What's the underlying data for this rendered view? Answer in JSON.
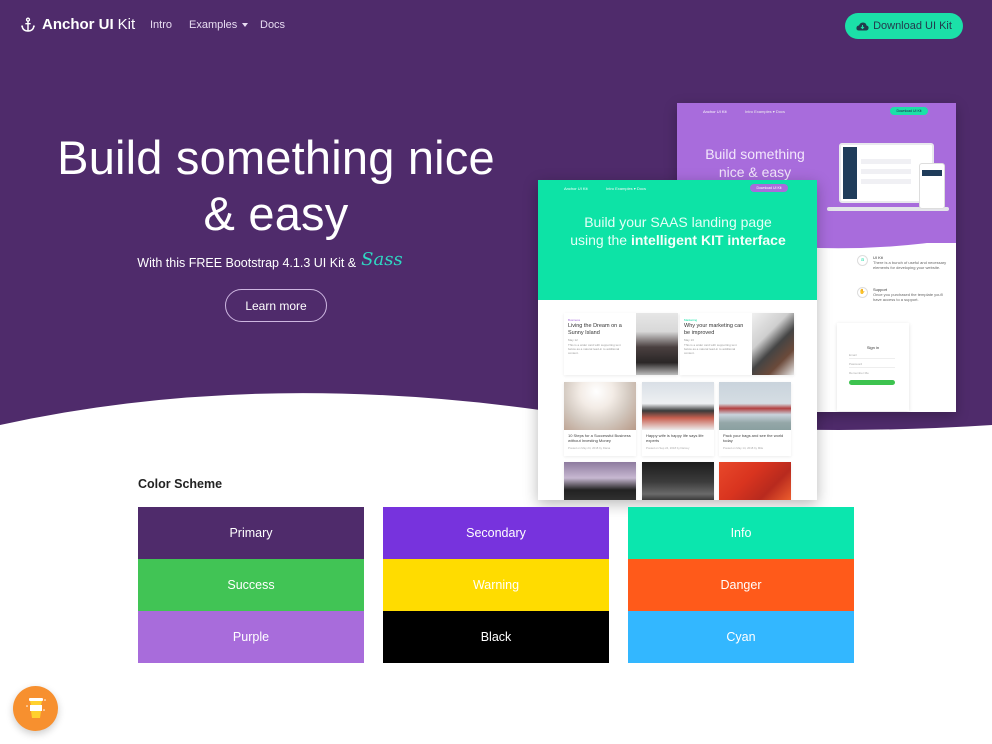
{
  "navbar": {
    "brand_bold": "Anchor UI",
    "brand_light": "Kit",
    "brand_icon": "anchor-icon",
    "links": [
      {
        "label": "Intro"
      },
      {
        "label": "Examples",
        "dropdown": true
      },
      {
        "label": "Docs"
      }
    ],
    "download_button": {
      "label": "Download UI Kit",
      "icon": "cloud-download-icon"
    }
  },
  "hero": {
    "title_line1": "Build something nice",
    "title_line2": "& easy",
    "subtitle": "With this FREE Bootstrap 4.1.3 UI Kit &",
    "sass_logo": "Sass",
    "cta_label": "Learn more",
    "background_color": "#4f2b6b"
  },
  "mockup_back": {
    "brand": "Anchor UI Kit",
    "nav_links": "Intro   Examples ▾   Docs",
    "download_label": "Download UI Kit",
    "title": "Build something nice & easy",
    "features": [
      {
        "icon": "a",
        "title": "UI Kit",
        "text": "There is a bunch of useful and necessary elements for developing your website."
      },
      {
        "icon": "✋",
        "title": "Support",
        "text": "Once you purchased the template you'll have access to a support."
      }
    ],
    "signin": {
      "title": "Sign in",
      "email": "Email",
      "password": "Password",
      "remember": "Remember Me"
    },
    "accent_color": "#a86cdc"
  },
  "mockup_front": {
    "brand": "Anchor UI Kit",
    "nav_links": "Intro   Examples ▾   Docs",
    "download_label": "Download UI Kit",
    "title_plain": "Build your SAAS landing page using the",
    "title_bold": "intelligent KIT interface",
    "accent_color": "#0de3a6",
    "wide_cards": [
      {
        "category": "Business",
        "title": "Living the Dream on a Sunny Island",
        "date": "May 12",
        "text": "This is a wider card with supporting text below as a natural lead-in to additional content."
      },
      {
        "category": "Marketing",
        "title": "Why your marketing can be improved",
        "date": "May 13",
        "text": "This is a wider card with supporting text below as a natural lead-in to additional content."
      }
    ],
    "small_cards": [
      {
        "title": "10 Steps for a Successful Business without Investing Money",
        "meta": "Posted on May 24, 2018 by Diana"
      },
      {
        "title": "Happy wife is happy life says life experts",
        "meta": "Posted on Sep 24, 2018 by Darcey"
      },
      {
        "title": "Pack your bags and see the world today",
        "meta": "Posted on May 14, 2018 by Mila"
      }
    ]
  },
  "color_scheme": {
    "title": "Color Scheme",
    "columns": [
      [
        {
          "label": "Primary",
          "color": "#4f2b6b"
        },
        {
          "label": "Success",
          "color": "#41c455"
        },
        {
          "label": "Purple",
          "color": "#a86cdb"
        }
      ],
      [
        {
          "label": "Secondary",
          "color": "#7733dd"
        },
        {
          "label": "Warning",
          "color": "#ffdc00"
        },
        {
          "label": "Black",
          "color": "#000000"
        }
      ],
      [
        {
          "label": "Info",
          "color": "#0be6ae"
        },
        {
          "label": "Danger",
          "color": "#ff5a1a"
        },
        {
          "label": "Cyan",
          "color": "#33b7ff"
        }
      ]
    ]
  },
  "floating_button": {
    "icon": "coffee-cup-icon",
    "color": "#f7902f"
  }
}
